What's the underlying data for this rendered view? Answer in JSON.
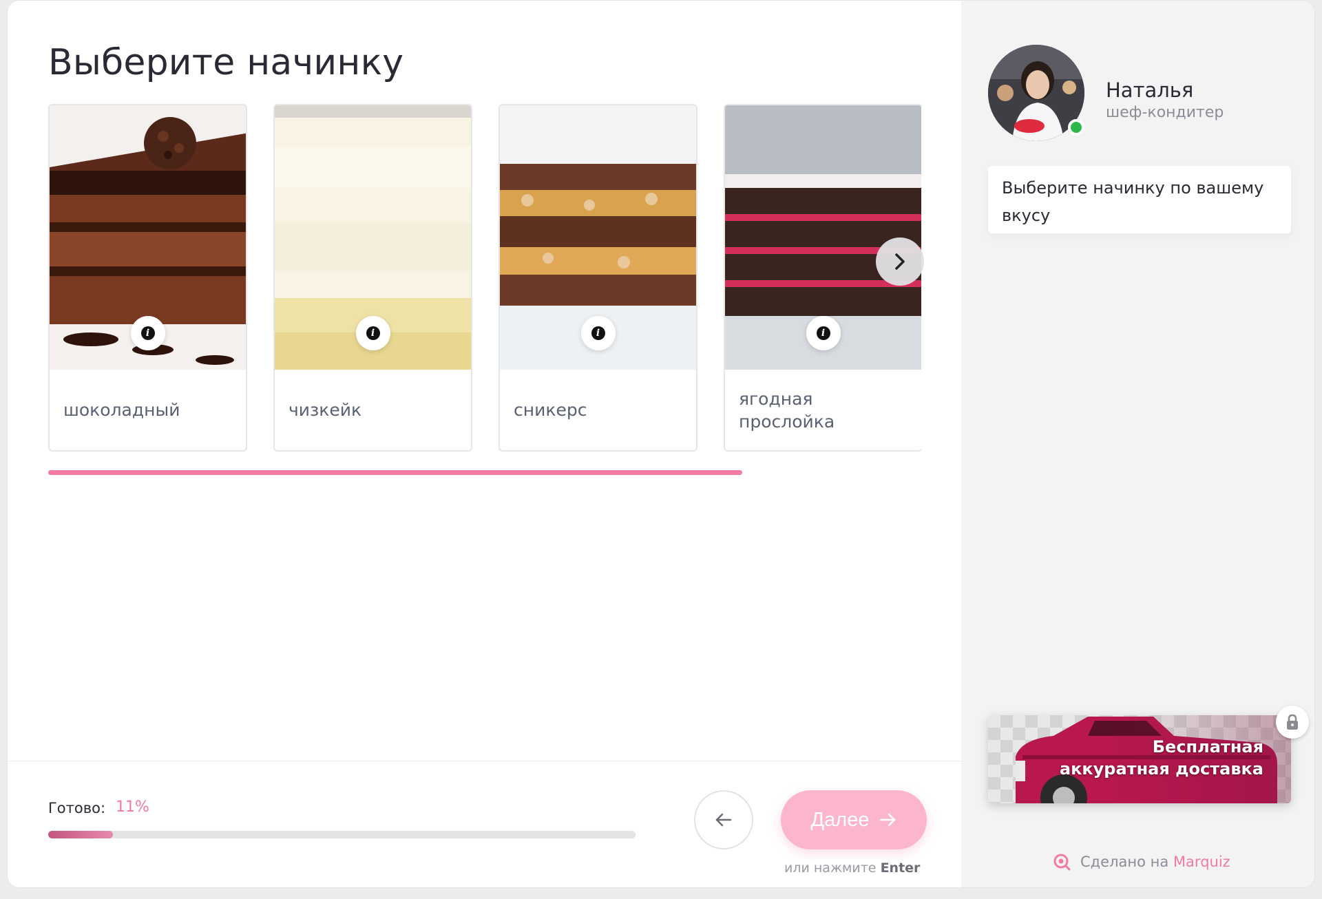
{
  "page": {
    "title": "Выберите начинку",
    "accent_color": "#f27aa3"
  },
  "options": [
    {
      "label": "шоколадный",
      "image": "chocolate-cake-image"
    },
    {
      "label": "чизкейк",
      "image": "cheesecake-image"
    },
    {
      "label": "сникерс",
      "image": "snickers-cake-image"
    },
    {
      "label": "ягодная прослойка",
      "image": "berry-layer-cake-image"
    }
  ],
  "footer": {
    "ready_label": "Готово:",
    "ready_value": "11%",
    "progress_fraction": 0.11,
    "next_label": "Далее",
    "hint_prefix": "или нажмите",
    "hint_key": "Enter"
  },
  "sidebar": {
    "name": "Наталья",
    "role": "шеф-кондитер",
    "message": "Выберите начинку по вашему вкусу",
    "promo_text_line1": "Бесплатная",
    "promo_text_line2": "аккуратная доставка",
    "made_with_prefix": "Сделано на",
    "made_with_brand": "Marquiz",
    "online_color": "#2db84a"
  }
}
